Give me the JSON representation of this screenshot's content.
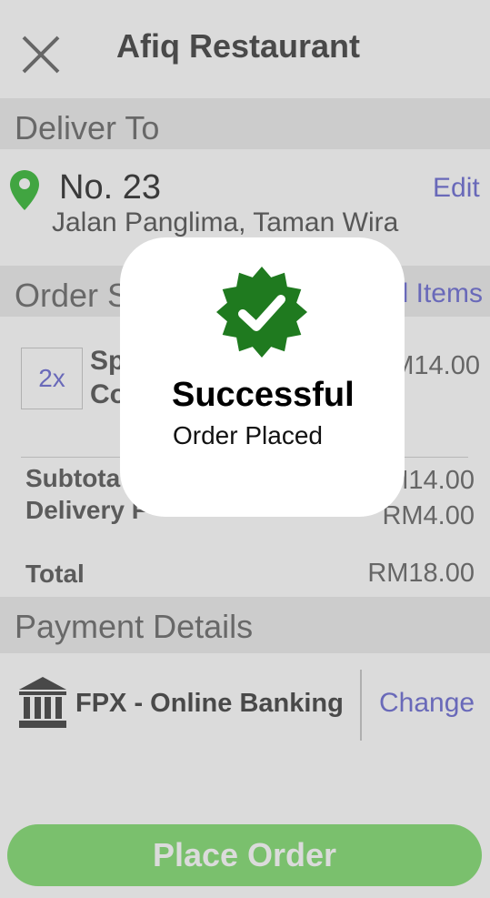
{
  "header": {
    "title": "Afiq Restaurant"
  },
  "delivery": {
    "section_title": "Deliver To",
    "address_line1": "No. 23",
    "address_line2": "Jalan Panglima, Taman Wira",
    "edit_label": "Edit"
  },
  "order": {
    "section_title": "Order S",
    "view_all_label": "l Items",
    "items": [
      {
        "qty": "2x",
        "name_line1": "Sp",
        "name_line2": "Co",
        "price": "M14.00"
      }
    ],
    "subtotal_label": "Subtota",
    "subtotal_value": "M14.00",
    "delivery_fee_label": "Delivery F",
    "delivery_fee_value": "RM4.00",
    "total_label": "Total",
    "total_value": "RM18.00"
  },
  "payment": {
    "section_title": "Payment Details",
    "method": "FPX - Online Banking",
    "change_label": "Change",
    "icon": "bank-icon"
  },
  "actions": {
    "place_order_label": "Place Order"
  },
  "modal": {
    "title": "Successful",
    "subtitle": "Order Placed",
    "icon": "check-badge-icon",
    "badge_color": "#1f7a1f"
  },
  "colors": {
    "accent_link": "#7b7bd8",
    "button_green": "#8fe07f",
    "pin_green": "#4cc04c"
  }
}
